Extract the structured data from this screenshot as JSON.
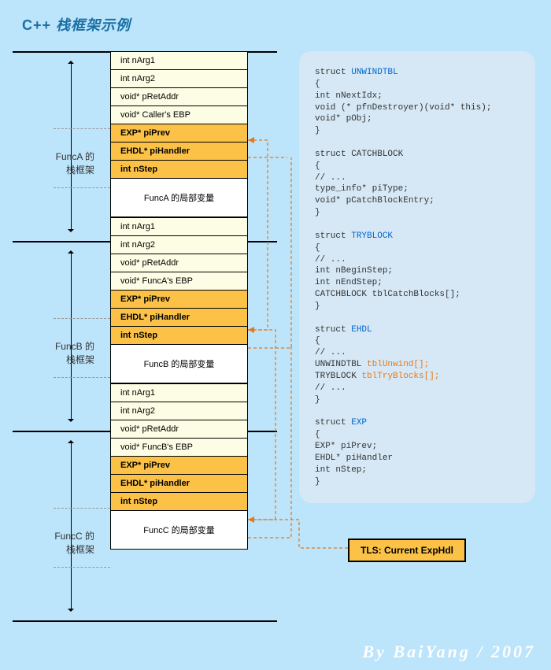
{
  "title_prefix": "C++",
  "title_rest": " 栈框架示例",
  "frames": [
    {
      "label": "FuncA 的\n栈框架",
      "cells": [
        {
          "text": "int nArg1",
          "kind": "normal"
        },
        {
          "text": "int nArg2",
          "kind": "normal"
        },
        {
          "text": "void* pRetAddr",
          "kind": "normal"
        },
        {
          "text": "void* Caller's EBP",
          "kind": "normal"
        },
        {
          "text": "EXP* piPrev",
          "kind": "hi"
        },
        {
          "text": "EHDL* piHandler",
          "kind": "hi"
        },
        {
          "text": "int nStep",
          "kind": "hi"
        },
        {
          "text": "FuncA 的局部变量",
          "kind": "tall"
        }
      ]
    },
    {
      "label": "FuncB 的\n栈框架",
      "cells": [
        {
          "text": "int nArg1",
          "kind": "normal"
        },
        {
          "text": "int nArg2",
          "kind": "normal"
        },
        {
          "text": "void* pRetAddr",
          "kind": "normal"
        },
        {
          "text": "void* FuncA's EBP",
          "kind": "normal"
        },
        {
          "text": "EXP* piPrev",
          "kind": "hi"
        },
        {
          "text": "EHDL* piHandler",
          "kind": "hi"
        },
        {
          "text": "int nStep",
          "kind": "hi"
        },
        {
          "text": "FuncB 的局部变量",
          "kind": "tall"
        }
      ]
    },
    {
      "label": "FuncC 的\n栈框架",
      "cells": [
        {
          "text": "int nArg1",
          "kind": "normal"
        },
        {
          "text": "int nArg2",
          "kind": "normal"
        },
        {
          "text": "void* pRetAddr",
          "kind": "normal"
        },
        {
          "text": "void* FuncB's EBP",
          "kind": "normal"
        },
        {
          "text": "EXP* piPrev",
          "kind": "hi"
        },
        {
          "text": "EHDL* piHandler",
          "kind": "hi"
        },
        {
          "text": "int nStep",
          "kind": "hi"
        },
        {
          "text": "FuncC 的局部变量",
          "kind": "tall"
        }
      ]
    }
  ],
  "code": {
    "s1_decl": "struct",
    "s1_name": "UNWINDTBL",
    "s1_body": [
      "{",
      "    int nNextIdx;",
      "    void (* pfnDestroyer)(void* this);",
      "    void* pObj;",
      "}"
    ],
    "s2_decl": "struct CATCHBLOCK",
    "s2_body": [
      "{",
      "    // ...",
      "    type_info* piType;",
      "    void* pCatchBlockEntry;",
      "}"
    ],
    "s3_decl": "struct",
    "s3_name": "TRYBLOCK",
    "s3_body": [
      "{",
      "    // ...",
      "    int nBeginStep;",
      "    int nEndStep;",
      "    CATCHBLOCK tblCatchBlocks[];",
      "}"
    ],
    "s4_decl": "struct",
    "s4_name": "EHDL",
    "s4_body_pre": [
      "{",
      "    // ..."
    ],
    "s4_line1_a": "    UNWINDTBL ",
    "s4_line1_b": "tblUnwind[];",
    "s4_line2_a": "    TRYBLOCK ",
    "s4_line2_b": "tblTryBlocks[];",
    "s4_body_post": [
      "    // ...",
      "}"
    ],
    "s5_decl": "struct",
    "s5_name": "EXP",
    "s5_body": [
      "{",
      "    EXP*     piPrev;",
      "    EHDL*   piHandler",
      "    int         nStep;",
      "}"
    ]
  },
  "tls_label": "TLS: Current ExpHdl",
  "credit": "By BaiYang / 2007"
}
